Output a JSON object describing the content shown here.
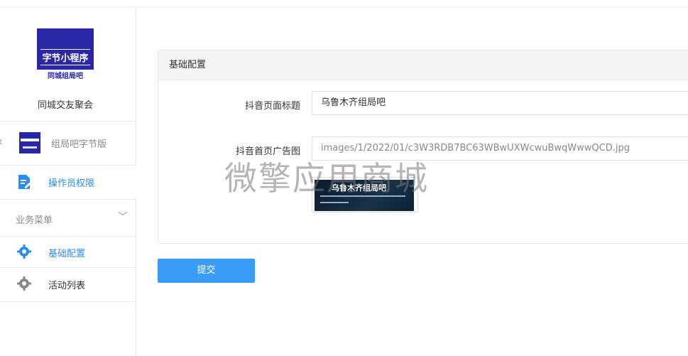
{
  "sidebar": {
    "logo_text": "字节小程序",
    "logo_sub": "同城组局吧",
    "app_name": "同城交友聚会",
    "app_switch_label": "组局吧字节版",
    "operator_label": "操作员权限",
    "group_label": "业务菜单",
    "items": [
      {
        "label": "基础配置",
        "icon": "gear-icon",
        "active": true
      },
      {
        "label": "活动列表",
        "icon": "gear-icon",
        "active": false
      }
    ]
  },
  "panel": {
    "title": "基础配置",
    "fields": [
      {
        "label": "抖音页面标题",
        "value": "乌鲁木齐组局吧"
      },
      {
        "label": "抖音首页广告图",
        "value": "images/1/2022/01/c3W3RDB7BC63WBwUXWcwuBwqWwwQCD.jpg"
      }
    ],
    "preview_title": "乌鲁木齐组局吧"
  },
  "submit_label": "提交",
  "watermark": "微擎应用商城",
  "colors": {
    "accent": "#2d8cf0",
    "button": "#3a9cf6",
    "logo_bg": "#2a27a6"
  }
}
